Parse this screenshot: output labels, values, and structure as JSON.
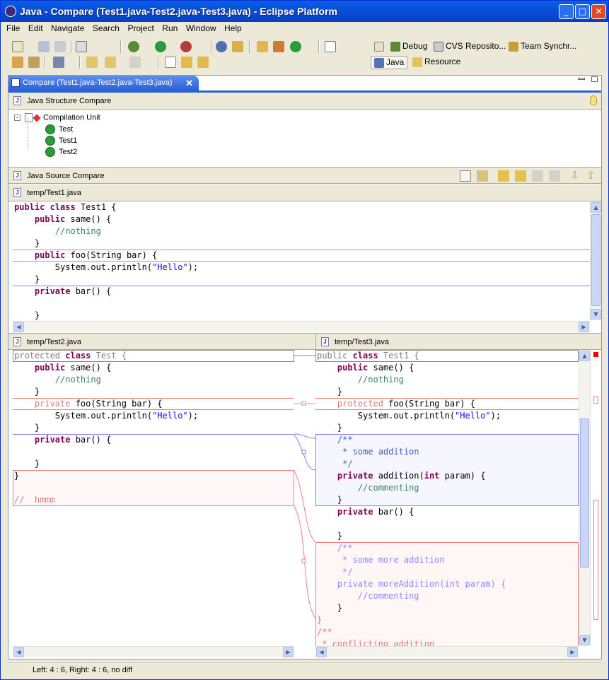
{
  "window": {
    "title": "Java - Compare (Test1.java-Test2.java-Test3.java) - Eclipse Platform"
  },
  "menu": [
    "File",
    "Edit",
    "Navigate",
    "Search",
    "Project",
    "Run",
    "Window",
    "Help"
  ],
  "perspectives": {
    "debug": "Debug",
    "cvs": "CVS Reposito...",
    "team": "Team Synchr...",
    "java": "Java",
    "resource": "Resource"
  },
  "editor_tab": {
    "label": "Compare (Test1.java-Test2.java-Test3.java)"
  },
  "structure": {
    "header": "Java Structure Compare",
    "root": "Compilation Unit",
    "children": [
      "Test",
      "Test1",
      "Test2"
    ]
  },
  "source": {
    "header": "Java Source Compare",
    "ancestor_file": "temp/Test1.java",
    "left_file": "temp/Test2.java",
    "right_file": "temp/Test3.java"
  },
  "ancestor_code": [
    "public class Test1 {",
    "    public same() {",
    "        //nothing",
    "    }",
    "    public foo(String bar) {",
    "        System.out.println(\"Hello\");",
    "    }",
    "    private bar() {",
    "",
    "    }"
  ],
  "left_code": [
    "protected class Test {",
    "    public same() {",
    "        //nothing",
    "    }",
    "    private foo(String bar) {",
    "        System.out.println(\"Hello\");",
    "    }",
    "    private bar() {",
    "",
    "    }",
    "}",
    "",
    "//  hmmm"
  ],
  "right_code": [
    "public class Test1 {",
    "    public same() {",
    "        //nothing",
    "    }",
    "    protected foo(String bar) {",
    "        System.out.println(\"Hello\");",
    "    }",
    "    /**",
    "     * some addition",
    "     */",
    "    private addition(int param) {",
    "        //commenting",
    "    }",
    "    private bar() {",
    "",
    "    }",
    "    /**",
    "     * some more addition",
    "     */",
    "    private moreAddition(int param) {",
    "        //commenting",
    "    }",
    "}",
    "/**",
    " * conflicting addition"
  ],
  "status": {
    "text": "Left: 4 : 6, Right: 4 : 6, no diff"
  }
}
